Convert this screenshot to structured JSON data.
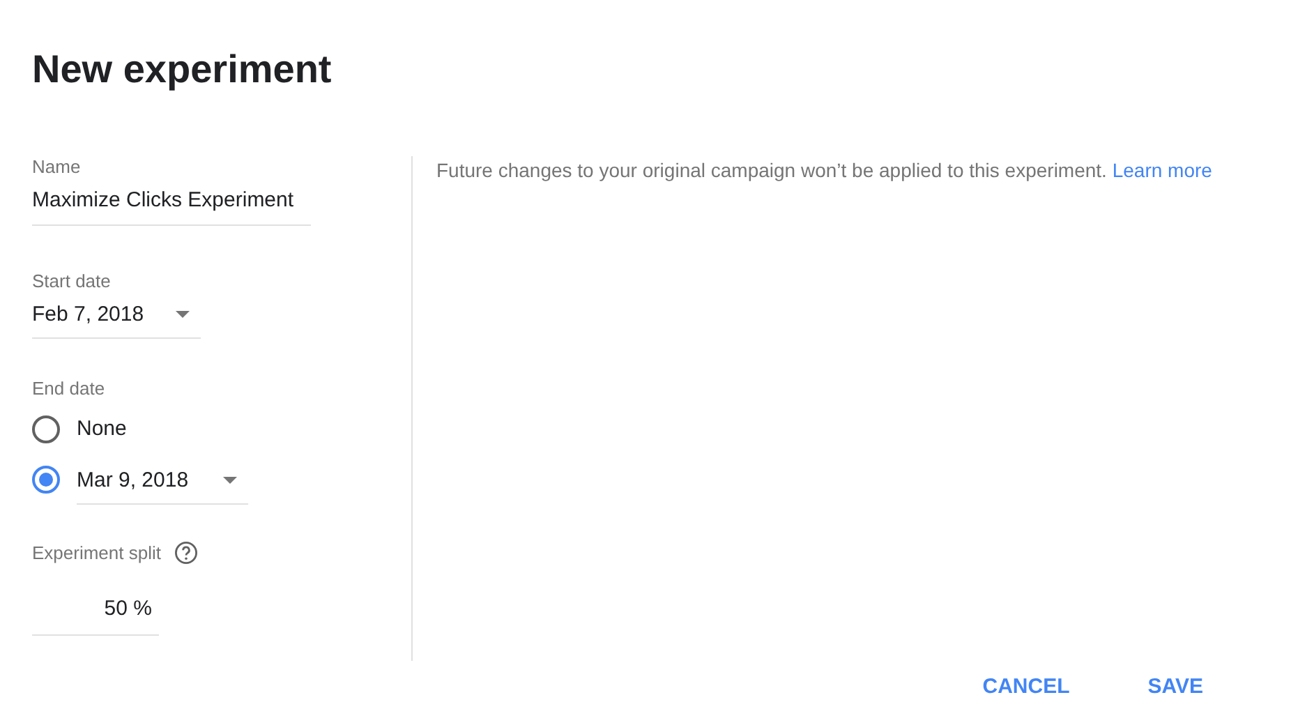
{
  "dialog": {
    "title": "New experiment"
  },
  "name_field": {
    "label": "Name",
    "value": "Maximize Clicks Experiment"
  },
  "start_date": {
    "label": "Start date",
    "value": "Feb 7, 2018"
  },
  "end_date": {
    "label": "End date",
    "options": [
      {
        "kind": "plain",
        "label": "None",
        "selected": false
      },
      {
        "kind": "dropdown",
        "label": "Mar 9, 2018",
        "selected": true
      }
    ]
  },
  "experiment_split": {
    "label": "Experiment split",
    "value": "50 %"
  },
  "note": {
    "text": "Future changes to your original campaign won’t be applied to this experiment.",
    "link": "Learn more"
  },
  "buttons": [
    "CANCEL",
    "SAVE"
  ]
}
